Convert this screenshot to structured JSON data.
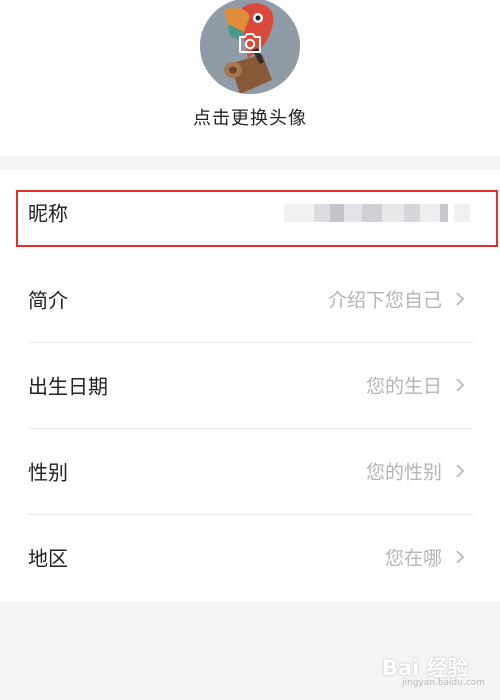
{
  "profile": {
    "avatar_caption": "点击更换头像"
  },
  "fields": [
    {
      "label": "昵称",
      "value": ""
    },
    {
      "label": "简介",
      "value": "介绍下您自己"
    },
    {
      "label": "出生日期",
      "value": "您的生日"
    },
    {
      "label": "性别",
      "value": "您的性别"
    },
    {
      "label": "地区",
      "value": "您在哪"
    }
  ],
  "colors": {
    "highlight": "#e12e2e",
    "background": "#f4f4f6",
    "placeholder": "#b4b4b8"
  },
  "watermark": {
    "text": "Bai 经验",
    "sub": "jingyan.baidu.com"
  }
}
